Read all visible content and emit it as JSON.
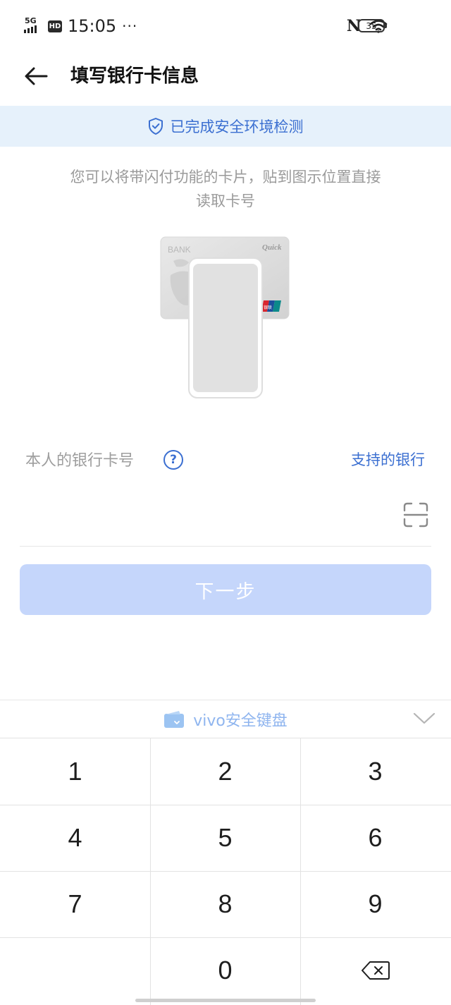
{
  "status_bar": {
    "network": "5G",
    "hd": "HD",
    "time": "15:05",
    "more": "···",
    "nfc": "N",
    "battery": "35"
  },
  "header": {
    "title": "填写银行卡信息"
  },
  "banner": {
    "text": "已完成安全环境检测"
  },
  "instruction": {
    "line1": "您可以将带闪付功能的卡片，贴到图示位置直接",
    "line2": "读取卡号"
  },
  "illustration": {
    "card_brand": "BANK",
    "quick_pass": "Quick",
    "unionpay": "银联"
  },
  "card_field": {
    "label": "本人的银行卡号",
    "help": "?",
    "supported_banks_link": "支持的银行",
    "value": ""
  },
  "next_button": {
    "label": "下一步"
  },
  "keyboard": {
    "title": "vivo安全键盘",
    "keys": [
      "1",
      "2",
      "3",
      "4",
      "5",
      "6",
      "7",
      "8",
      "9",
      "",
      "0"
    ]
  },
  "colors": {
    "accent": "#3b6fd1",
    "banner_bg": "#e6f1fb",
    "button_disabled": "#c5d6fb",
    "keyboard_title": "#8fb5ef"
  },
  "icons": {
    "back": "back-arrow-icon",
    "shield": "shield-check-icon",
    "help": "question-circle-icon",
    "scan": "scan-frame-icon",
    "wallet": "wallet-icon",
    "collapse": "chevron-down-icon",
    "backspace": "backspace-icon",
    "wifi": "wifi-icon",
    "nfc": "nfc-icon"
  }
}
